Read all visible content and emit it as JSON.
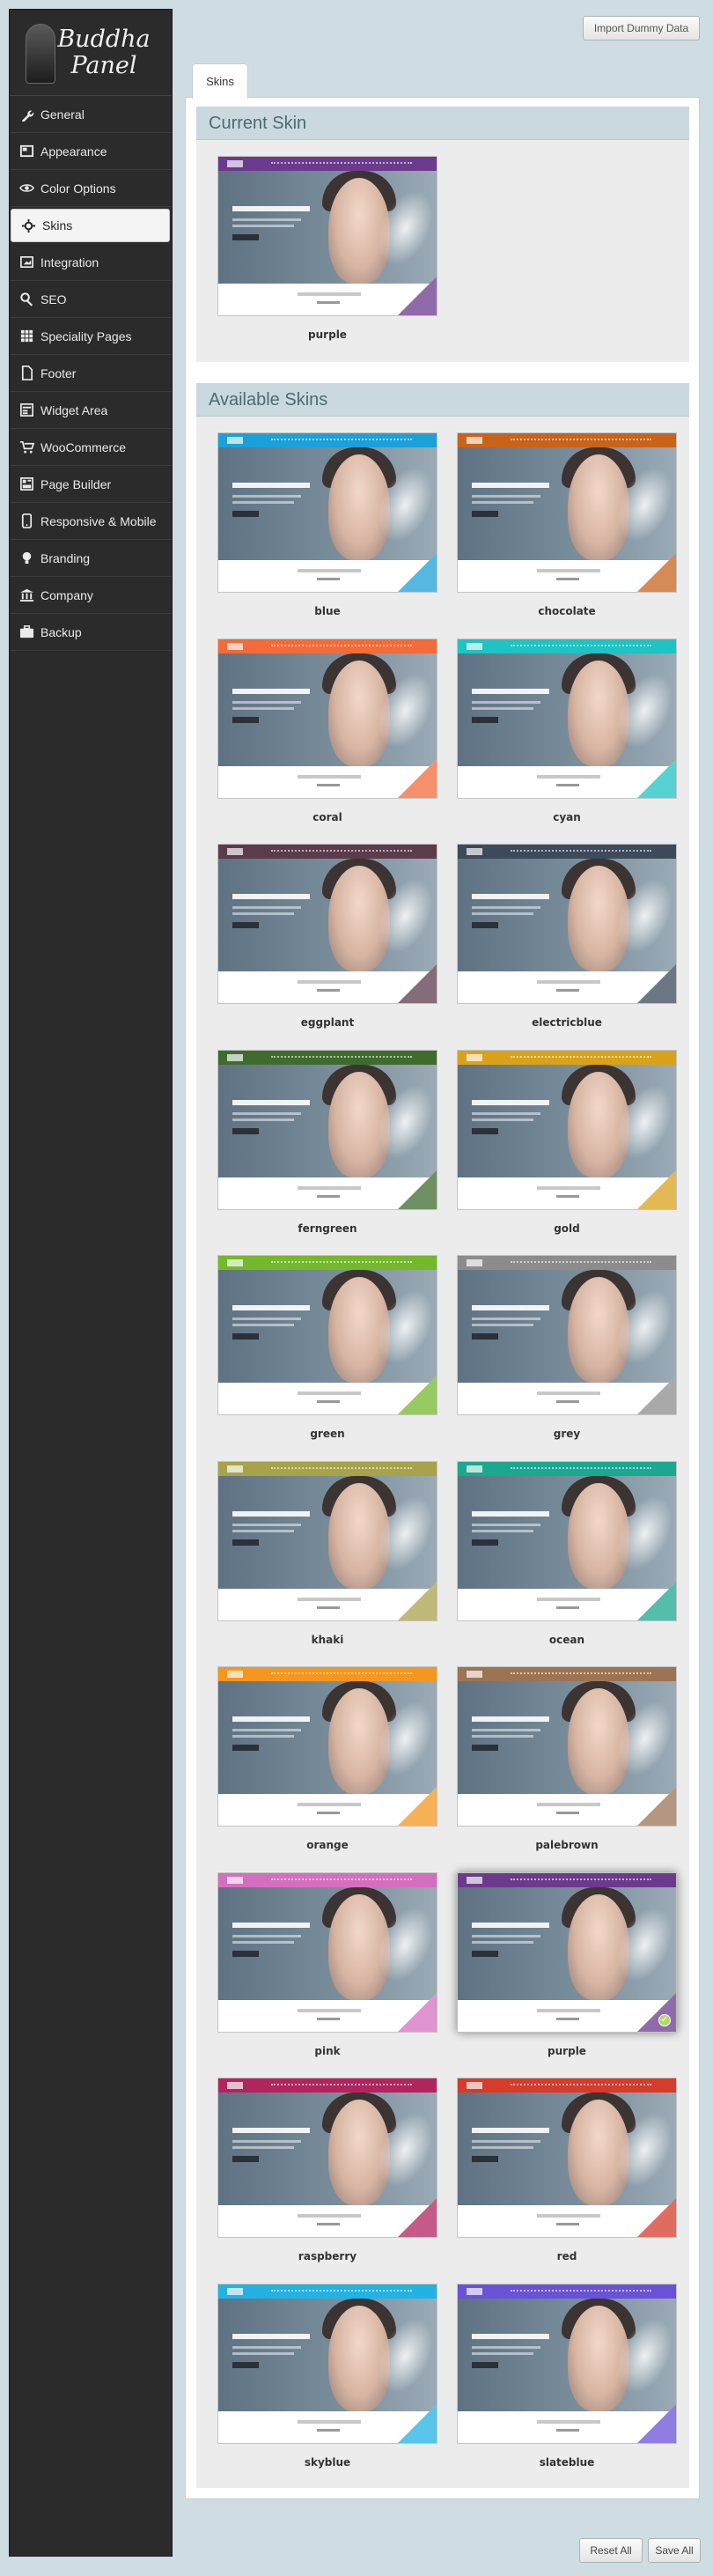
{
  "logo": {
    "line1": "Buddha",
    "line2": "Panel"
  },
  "sidebar": {
    "items": [
      {
        "label": "General",
        "icon": "wrench-icon"
      },
      {
        "label": "Appearance",
        "icon": "layout-icon"
      },
      {
        "label": "Color Options",
        "icon": "eye-icon"
      },
      {
        "label": "Skins",
        "icon": "gear-icon"
      },
      {
        "label": "Integration",
        "icon": "integration-icon"
      },
      {
        "label": "SEO",
        "icon": "search-icon"
      },
      {
        "label": "Speciality Pages",
        "icon": "grid-icon"
      },
      {
        "label": "Footer",
        "icon": "document-icon"
      },
      {
        "label": "Widget Area",
        "icon": "widget-icon"
      },
      {
        "label": "WooCommerce",
        "icon": "cart-icon"
      },
      {
        "label": "Page Builder",
        "icon": "builder-icon"
      },
      {
        "label": "Responsive & Mobile",
        "icon": "mobile-icon"
      },
      {
        "label": "Branding",
        "icon": "lightbulb-icon"
      },
      {
        "label": "Company",
        "icon": "bank-icon"
      },
      {
        "label": "Backup",
        "icon": "briefcase-icon"
      }
    ],
    "active_index": 3
  },
  "toolbar": {
    "import_label": "Import Dummy Data",
    "reset_label": "Reset All",
    "save_label": "Save All"
  },
  "tabs": [
    {
      "label": "Skins"
    }
  ],
  "current": {
    "title": "Current Skin",
    "skin": {
      "name": "purple",
      "color": "#6b3a8c"
    }
  },
  "available": {
    "title": "Available Skins",
    "selected": "purple",
    "skins": [
      {
        "name": "blue",
        "color": "#1ba1d8"
      },
      {
        "name": "chocolate",
        "color": "#c8631c"
      },
      {
        "name": "coral",
        "color": "#f26b38"
      },
      {
        "name": "cyan",
        "color": "#1ec3c3"
      },
      {
        "name": "eggplant",
        "color": "#5b3b4c"
      },
      {
        "name": "electricblue",
        "color": "#3c4a5b"
      },
      {
        "name": "ferngreen",
        "color": "#3f6b2e"
      },
      {
        "name": "gold",
        "color": "#d9a21a"
      },
      {
        "name": "green",
        "color": "#74b82b"
      },
      {
        "name": "grey",
        "color": "#8c8c8c"
      },
      {
        "name": "khaki",
        "color": "#a8a24b"
      },
      {
        "name": "ocean",
        "color": "#1aa88f"
      },
      {
        "name": "orange",
        "color": "#f5961e"
      },
      {
        "name": "palebrown",
        "color": "#9c7454"
      },
      {
        "name": "pink",
        "color": "#d46fc0"
      },
      {
        "name": "purple",
        "color": "#6b3a8c"
      },
      {
        "name": "raspberry",
        "color": "#b1245e"
      },
      {
        "name": "red",
        "color": "#d63b2b"
      },
      {
        "name": "skyblue",
        "color": "#22b2e4"
      },
      {
        "name": "slateblue",
        "color": "#6a52d6"
      }
    ]
  }
}
